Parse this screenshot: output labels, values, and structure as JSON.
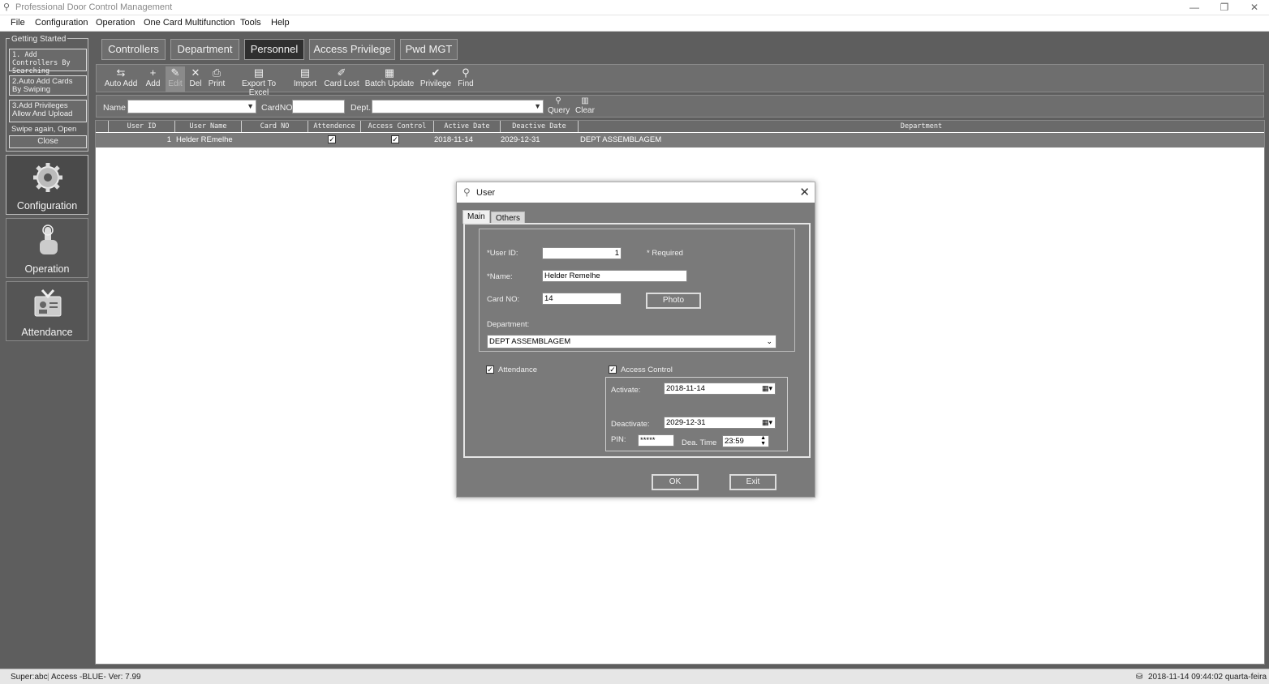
{
  "window": {
    "title": "Professional Door Control Management",
    "controls": {
      "minimize": "—",
      "restore": "❐",
      "close": "✕"
    }
  },
  "menu": [
    "File",
    "Configuration",
    "Operation",
    "One Card Multifunction",
    "Tools",
    "Help"
  ],
  "getting_started": {
    "legend": "Getting Started",
    "items": [
      "1. Add Controllers By Searching",
      "2.Auto Add Cards By Swiping",
      "3.Add Privileges Allow And Upload"
    ],
    "swipe_text": "Swipe again, Open",
    "close_label": "Close"
  },
  "nav": [
    {
      "label": "Configuration",
      "icon": "gear-icon",
      "active": true
    },
    {
      "label": "Operation",
      "icon": "hand-pointer-icon",
      "active": false
    },
    {
      "label": "Attendance",
      "icon": "id-card-icon",
      "active": false
    }
  ],
  "top_tabs": [
    {
      "label": "Controllers",
      "active": false
    },
    {
      "label": "Department",
      "active": false
    },
    {
      "label": "Personnel",
      "active": true
    },
    {
      "label": "Access Privilege",
      "active": false
    },
    {
      "label": "Pwd MGT",
      "active": false
    }
  ],
  "toolbar": [
    {
      "label": "Auto Add",
      "icon": "auto-add-icon",
      "glyph": "⇆"
    },
    {
      "label": "Add",
      "icon": "plus-icon",
      "glyph": "+"
    },
    {
      "label": "Edit",
      "icon": "pencil-icon",
      "glyph": "✎",
      "disabled": true
    },
    {
      "label": "Del",
      "icon": "delete-icon",
      "glyph": "✕"
    },
    {
      "label": "Print",
      "icon": "printer-icon",
      "glyph": "⎙"
    },
    {
      "label": "Export To Excel",
      "icon": "excel-icon",
      "glyph": "▤"
    },
    {
      "label": "Import",
      "icon": "import-icon",
      "glyph": "▤"
    },
    {
      "label": "Card Lost",
      "icon": "card-lost-icon",
      "glyph": "✐"
    },
    {
      "label": "Batch Update",
      "icon": "batch-update-icon",
      "glyph": "▦"
    },
    {
      "label": "Privilege",
      "icon": "privilege-icon",
      "glyph": "✔"
    },
    {
      "label": "Find",
      "icon": "find-icon",
      "glyph": "⚲"
    }
  ],
  "filter": {
    "name_label": "Name",
    "cardno_label": "CardNO",
    "dept_label": "Dept.",
    "query_label": "Query",
    "clear_label": "Clear"
  },
  "grid": {
    "columns": [
      "User ID",
      "User Name",
      "Card NO",
      "Attendence",
      "Access Control",
      "Active Date",
      "Deactive Date",
      "Department"
    ],
    "rows": [
      {
        "user_id": "1",
        "user_name": "Helder REmelhe",
        "card_no": "",
        "attendance": true,
        "access_control": true,
        "active_date": "2018-11-14",
        "deactive_date": "2029-12-31",
        "department": "DEPT ASSEMBLAGEM"
      }
    ]
  },
  "dialog": {
    "title": "User",
    "tabs": [
      "Main",
      "Others"
    ],
    "active_tab": "Main",
    "user_id_label": "*User ID:",
    "user_id": "1",
    "required_note": "* Required",
    "name_label": "*Name:",
    "name": "Helder Remelhe",
    "card_label": "Card NO:",
    "card_no": "14",
    "photo_label": "Photo",
    "department_label": "Department:",
    "department": "DEPT ASSEMBLAGEM",
    "attendance_label": "Attendance",
    "attendance_checked": true,
    "access_control_label": "Access Control",
    "access_control_checked": true,
    "activate_label": "Activate:",
    "activate": "2018-11-14",
    "deactivate_label": "Deactivate:",
    "deactivate": "2029-12-31",
    "pin_label": "PIN:",
    "pin": "*****",
    "dea_time_label": "Dea. Time",
    "dea_time": "23:59",
    "ok_label": "OK",
    "exit_label": "Exit"
  },
  "status": {
    "user": "Super:abc",
    "version": "Access -BLUE- Ver: 7.99",
    "datetime": "2018-11-14 09:44:02 quarta-feira"
  }
}
